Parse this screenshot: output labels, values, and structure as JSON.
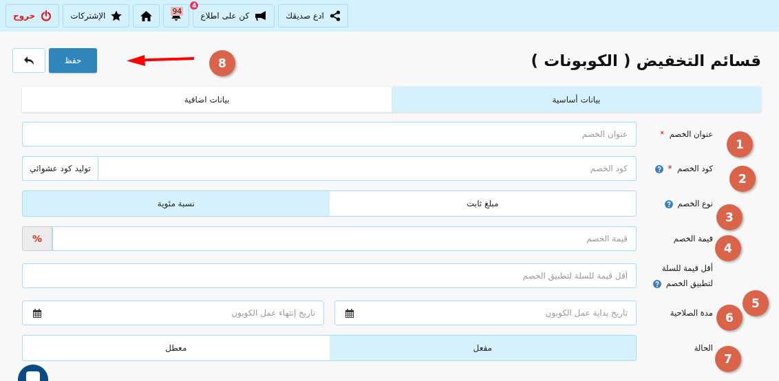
{
  "topbar": {
    "buttons": [
      {
        "kind": "share",
        "label": "ادع صديقك"
      },
      {
        "kind": "announce",
        "label": "كن على اطلاع",
        "badge": "4"
      },
      {
        "kind": "bell",
        "badge": "94"
      },
      {
        "kind": "home"
      },
      {
        "kind": "star",
        "label": "الإشتركات"
      },
      {
        "kind": "logout",
        "label": "خروج"
      }
    ]
  },
  "page_title": "قسائم التخفيض ( الكوبونات )",
  "save_button": "حفظ",
  "tabs": [
    {
      "label": "بيانات أساسية",
      "selected": true
    },
    {
      "label": "بيانات اضافية",
      "selected": false
    }
  ],
  "fields": [
    {
      "kind": "text",
      "label": "عنوان الخصم",
      "required_mark": "*",
      "help": false,
      "placeholder": "عنوان الخصم"
    },
    {
      "kind": "code",
      "label": "كود الخصم",
      "required_mark": "*",
      "help": true,
      "placeholder": "كود الخصم",
      "button": "توليد كود عشوائي"
    },
    {
      "kind": "toggle",
      "label": "نوع الخصم",
      "help": true,
      "options": [
        {
          "label": "مبلغ ثابت",
          "selected": false
        },
        {
          "label": "نسبة مئوية",
          "selected": true
        }
      ]
    },
    {
      "kind": "addon",
      "label": "قيمة الخصم",
      "help": false,
      "placeholder": "قيمة الخصم",
      "addon": "%"
    },
    {
      "kind": "text",
      "label": "أقل قيمة للسلة لتطبيق الخصم",
      "help": true,
      "placeholder": "أقل قيمة للسلة لتطبيق الخصم"
    },
    {
      "kind": "daterange",
      "label": "مدة الصلاحية",
      "help": false,
      "placeholders": [
        "تاريخ بداية عمل الكوبون",
        "تاريخ إنتهاء عمل الكوبون"
      ]
    },
    {
      "kind": "toggle",
      "label": "الحالة",
      "help": false,
      "options": [
        {
          "label": "مفعل",
          "selected": true
        },
        {
          "label": "معطل",
          "selected": false
        }
      ]
    }
  ],
  "callouts": [
    "1",
    "2",
    "3",
    "4",
    "5",
    "6",
    "7",
    "8"
  ]
}
